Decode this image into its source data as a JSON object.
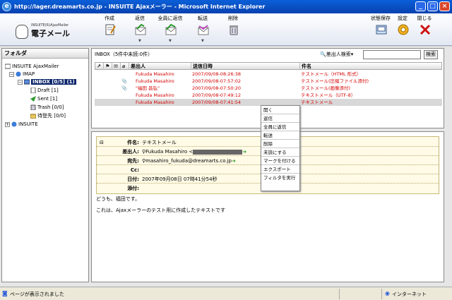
{
  "window": {
    "title": "http://lager.dreamarts.co.jp - INSUITE Ajaxメーラー - Microsoft Internet Explorer"
  },
  "logo": {
    "sub": "INSUITE(R)AjaxMailer",
    "main": "電子メール"
  },
  "toolbar": {
    "compose": "作成",
    "reply": "返信",
    "reply_all": "全員に返信",
    "forward": "転送",
    "delete": "削除",
    "save_state": "状態保存",
    "settings": "設定",
    "close": "閉じる"
  },
  "folder_panel": {
    "header": "フォルダ",
    "root": "INSUITE AjaxMailer",
    "imap": "IMAP",
    "inbox": "INBOX [0/5] (1)",
    "draft": "Draft [1]",
    "sent": "Sent [1]",
    "trash": "Trash [0/0]",
    "pending": "待登先 [0/0]",
    "insuite": "INSUITE"
  },
  "list": {
    "inbox_label": "INBOX（5件中未読:0件）",
    "search_label": "差出人検索",
    "search_button": "検索",
    "columns": {
      "sender": "差出人",
      "date": "送信日時",
      "subject": "件名"
    },
    "rows": [
      {
        "sender": "Fukuda Masahiro",
        "date": "2007/09/08-08:26:38",
        "subject": "テストメール（HTML 形式）",
        "attach": false
      },
      {
        "sender": "Fukuda Masahiro",
        "date": "2007/09/08-07:57:02",
        "subject": "テストメール(圧縮ファイル添付)",
        "attach": true
      },
      {
        "sender": "\"福田 昌弘\"",
        "date": "2007/09/08-07:50:20",
        "subject": "テストメール(画像添付)",
        "attach": true
      },
      {
        "sender": "Fukuda Masahiro",
        "date": "2007/09/08-07:49:12",
        "subject": "テキストメール（UTF-8）",
        "attach": false
      },
      {
        "sender": "Fukuda Masahiro",
        "date": "2007/09/08-07:41:54",
        "subject": "テキストメール",
        "attach": false
      }
    ]
  },
  "context_menu": {
    "open": "開く",
    "reply": "返信",
    "reply_all": "全員に返信",
    "forward": "転送",
    "delete": "削除",
    "mark_unread": "未読にする",
    "mark": "マークを付ける",
    "export": "エクスポート",
    "run_filter": "フィルタを実行"
  },
  "preview": {
    "subject_label": "件名:",
    "subject": "テキストメール",
    "from_label": "差出人:",
    "from": "Fukuda Masahiro <",
    "to_label": "宛先:",
    "to": "masahiro_fukuda@dreamarts.co.jp",
    "cc_label": "Cc:",
    "date_label": "日付:",
    "date": "2007年09月08日 07時41分54秒",
    "attach_label": "添付:",
    "body_line1": "どうも、福田です。",
    "body_line2": "これは、Ajaxメーラーのテスト用に作成したテキストです"
  },
  "status": {
    "text": "ページが表示されました",
    "zone": "インターネット"
  },
  "colors": {
    "accent": "#0a246a",
    "unread_red": "#d40000",
    "title_blue": "#0842b0"
  }
}
